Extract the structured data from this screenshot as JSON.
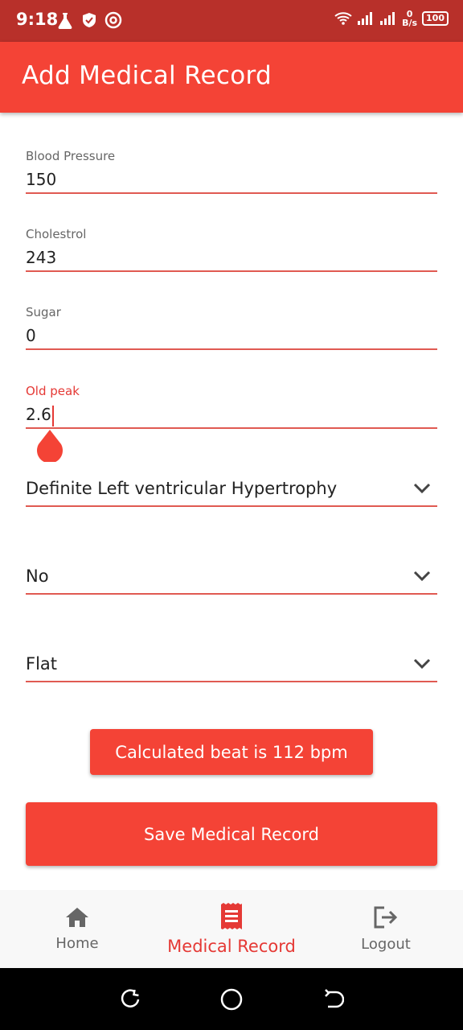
{
  "status_bar": {
    "time": "9:18",
    "network_speed_value": "0",
    "network_speed_unit": "B/s",
    "battery": "100"
  },
  "app_bar": {
    "title": "Add Medical Record"
  },
  "form": {
    "blood_pressure": {
      "label": "Blood Pressure",
      "value": "150"
    },
    "cholesterol": {
      "label": "Cholestrol",
      "value": "243"
    },
    "sugar": {
      "label": "Sugar",
      "value": "0"
    },
    "old_peak": {
      "label": "Old peak",
      "value": "2.6"
    },
    "ecg_dropdown": {
      "value": "Definite Left ventricular Hypertrophy"
    },
    "exercise_angina_dropdown": {
      "value": "No"
    },
    "slope_dropdown": {
      "value": "Flat"
    }
  },
  "calculated_beat_button": {
    "label": "Calculated beat is 112 bpm"
  },
  "save_button": {
    "label": "Save Medical Record"
  },
  "bottom_nav": {
    "items": [
      {
        "label": "Home",
        "icon": "home-icon",
        "active": false
      },
      {
        "label": "Medical Record",
        "icon": "receipt-icon",
        "active": true
      },
      {
        "label": "Logout",
        "icon": "logout-icon",
        "active": false
      }
    ]
  },
  "colors": {
    "primary": "#f44336",
    "status_bar": "#b8302a",
    "accent_text": "#e53935"
  }
}
